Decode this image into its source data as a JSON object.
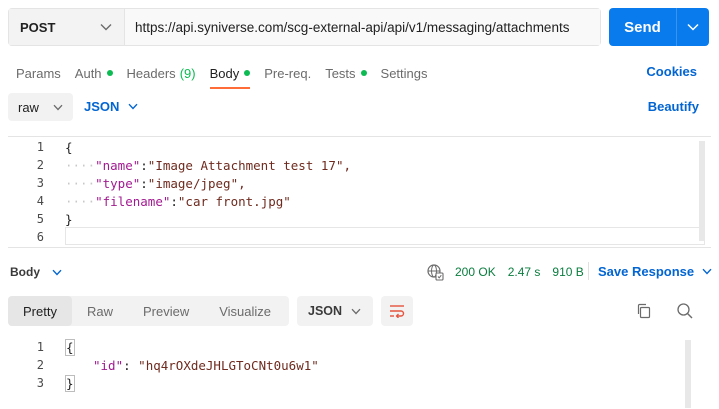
{
  "request": {
    "method": "POST",
    "url": "https://api.syniverse.com/scg-external-api/api/v1/messaging/attachments",
    "send_label": "Send"
  },
  "tabs": [
    {
      "label": "Params"
    },
    {
      "label": "Auth"
    },
    {
      "label": "Headers",
      "count": "(9)"
    },
    {
      "label": "Body"
    },
    {
      "label": "Pre-req."
    },
    {
      "label": "Tests"
    },
    {
      "label": "Settings"
    }
  ],
  "cookies_label": "Cookies",
  "body_options": {
    "mode": "raw",
    "language": "JSON",
    "beautify_label": "Beautify"
  },
  "request_body": {
    "line_numbers": [
      "1",
      "2",
      "3",
      "4",
      "5",
      "6"
    ],
    "open_brace": "{",
    "close_brace": "}",
    "fields": [
      {
        "key": "\"name\"",
        "value": "\"Image Attachment test 17\","
      },
      {
        "key": "\"type\"",
        "value": "\"image/jpeg\","
      },
      {
        "key": "\"filename\"",
        "value": "\"car front.jpg\""
      }
    ]
  },
  "response": {
    "label": "Body",
    "status": "200 OK",
    "time": "2.47 s",
    "size": "910 B",
    "save_label": "Save Response",
    "view_tabs": [
      "Pretty",
      "Raw",
      "Preview",
      "Visualize"
    ],
    "format": "JSON",
    "line_numbers": [
      "1",
      "2",
      "3"
    ],
    "open_brace": "{",
    "close_brace": "}",
    "field_key": "\"id\"",
    "field_value": "\"hq4rOXdeJHLGToCNt0u6w1\""
  },
  "colors": {
    "accent": "#097bed",
    "link": "#0265d2",
    "active_tab_underline": "#ff6c37",
    "status_ok": "#0a7d3e",
    "dot": "#0cbb52"
  }
}
